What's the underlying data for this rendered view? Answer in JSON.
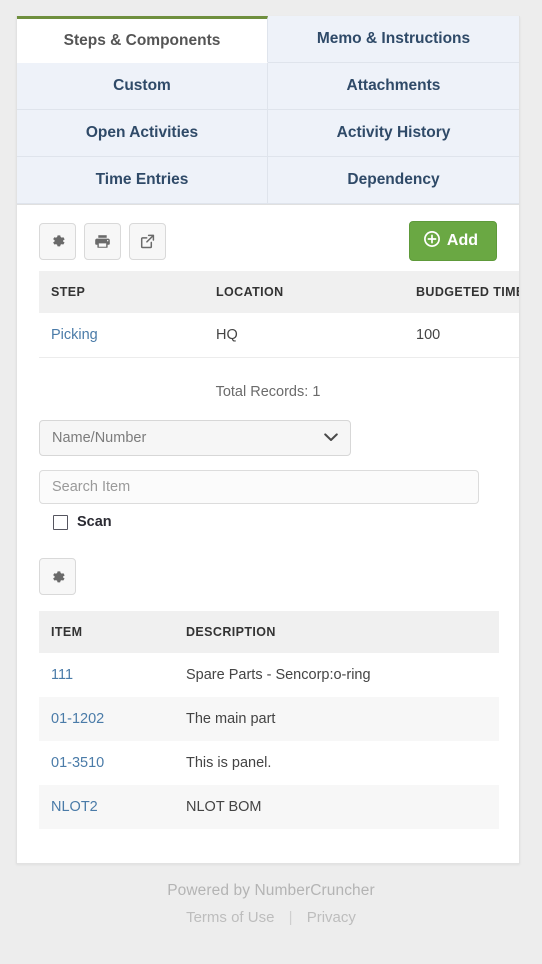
{
  "tabs": [
    {
      "label": "Steps & Components",
      "active": true
    },
    {
      "label": "Memo & Instructions",
      "active": false
    },
    {
      "label": "Custom",
      "active": false
    },
    {
      "label": "Attachments",
      "active": false
    },
    {
      "label": "Open Activities",
      "active": false
    },
    {
      "label": "Activity History",
      "active": false
    },
    {
      "label": "Time Entries",
      "active": false
    },
    {
      "label": "Dependency",
      "active": false
    }
  ],
  "toolbar": {
    "settings_icon": "gear-icon",
    "print_icon": "printer-icon",
    "export_icon": "share-export-icon",
    "add_label": "Add",
    "add_icon": "plus-circle-icon",
    "add_color": "#6aa843"
  },
  "steps_table": {
    "columns": [
      "STEP",
      "LOCATION",
      "BUDGETED TIME"
    ],
    "rows": [
      {
        "step": "Picking",
        "location": "HQ",
        "budgeted_time": "100"
      }
    ],
    "total_records_label": "Total Records:",
    "total_records_value": "1"
  },
  "filters": {
    "search_type_value": "Name/Number",
    "search_type_icon": "chevron-down-icon",
    "search_placeholder": "Search Item",
    "search_value": "",
    "scan_label": "Scan",
    "scan_checked": false
  },
  "items_toolbar": {
    "settings_icon": "gear-icon"
  },
  "items_table": {
    "columns": [
      "ITEM",
      "DESCRIPTION"
    ],
    "rows": [
      {
        "item": "111",
        "description": "Spare Parts - Sencorp:o-ring"
      },
      {
        "item": "01-1202",
        "description": "The main part"
      },
      {
        "item": "01-3510",
        "description": "This is panel."
      },
      {
        "item": "NLOT2",
        "description": "NLOT BOM"
      }
    ]
  },
  "footer": {
    "powered_by": "Powered by NumberCruncher",
    "terms_label": "Terms of Use",
    "separator": "|",
    "privacy_label": "Privacy"
  },
  "colors": {
    "page_background": "#ededed",
    "tab_inactive_bg": "#eef2f9",
    "tab_text": "#2f4a68",
    "active_tab_accent": "#6f8f3e",
    "link": "#4a7ba8"
  }
}
